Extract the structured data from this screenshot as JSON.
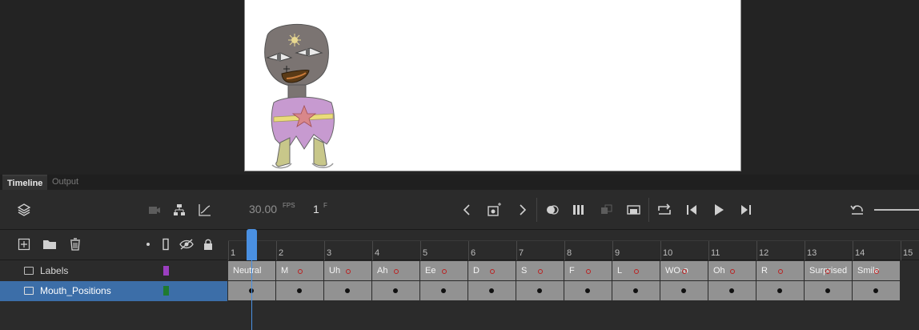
{
  "panel_tabs": {
    "timeline": "Timeline",
    "output": "Output"
  },
  "toolbar": {
    "fps_value": "30.00",
    "fps_unit": "FPS",
    "frame_value": "1",
    "frame_unit": "F"
  },
  "ruler": {
    "frames": [
      "1",
      "2",
      "3",
      "4",
      "5",
      "6",
      "7",
      "8",
      "9",
      "10",
      "11",
      "12",
      "13",
      "14",
      "15"
    ]
  },
  "layers": [
    {
      "name": "Labels",
      "color": "#9b3fc0"
    },
    {
      "name": "Mouth_Positions",
      "color": "#1f7a30"
    }
  ],
  "frame_labels": [
    "Neutral",
    "M",
    "Uh",
    "Ah",
    "Ee",
    "D",
    "S",
    "F",
    "L",
    "WO-o",
    "Oh",
    "R",
    "Surprised",
    "Smile"
  ],
  "icons": {
    "layers": "layers-icon",
    "camera": "camera-icon",
    "hierarchy": "hierarchy-icon",
    "graph": "graph-icon",
    "prev": "chevron-left-icon",
    "insert-keyframe": "insert-keyframe-icon",
    "next": "chevron-right-icon",
    "onion-skin": "onion-skin-icon",
    "edit-multiple": "edit-multiple-frames-icon",
    "loop": "loop-icon",
    "step-back": "step-back-icon",
    "play": "play-icon",
    "step-forward": "step-forward-icon",
    "undo": "undo-icon"
  },
  "colors": {
    "selected_layer": "#3c6ea8",
    "playhead": "#4a90e2",
    "frame_fill": "#929292"
  }
}
